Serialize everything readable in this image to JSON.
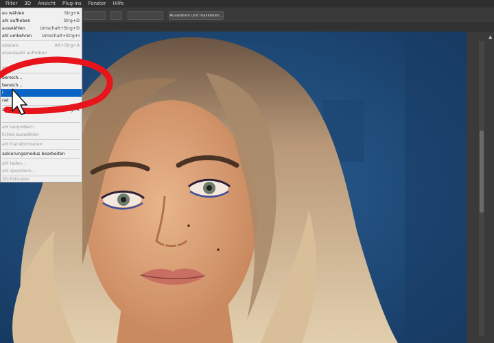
{
  "menubar": {
    "items": [
      "Filter",
      "3D",
      "Ansicht",
      "Plug-ins",
      "Fenster",
      "Hilfe"
    ]
  },
  "options": {
    "select_mask_button": "Auswählen und maskieren..."
  },
  "menu": {
    "items": [
      {
        "label": "eu wählen",
        "shortcut": "Strg+A",
        "disabled": false
      },
      {
        "label": "ahl aufheben",
        "shortcut": "Strg+D",
        "disabled": false
      },
      {
        "label": "auswählen",
        "shortcut": "Umschalt+Strg+D",
        "disabled": false
      },
      {
        "label": "ahl umkehren",
        "shortcut": "Umschalt+Strg+I",
        "disabled": false
      },
      {
        "label": "ebenen",
        "shortcut": "Alt+Strg+A",
        "disabled": true
      },
      {
        "label": "enauswahl aufheben",
        "shortcut": "",
        "disabled": true
      },
      {
        "label": "",
        "shortcut": "Alt+Umschalt+Strg+F",
        "disabled": true
      },
      {
        "label": "ebenen",
        "shortcut": "",
        "disabled": true
      },
      {
        "label": "bereich...",
        "shortcut": "",
        "disabled": false
      },
      {
        "label": "bereich...",
        "shortcut": "",
        "disabled": false
      },
      {
        "label": "l",
        "shortcut": "",
        "disabled": false,
        "selected": true
      },
      {
        "label": "nel",
        "shortcut": "",
        "disabled": false
      },
      {
        "label": "ählen und maskieren...",
        "shortcut": "Alt+Strg+R",
        "disabled": false
      },
      {
        "label": "",
        "shortcut": "",
        "disabled": false
      },
      {
        "label": "ahl vergrößern",
        "shortcut": "",
        "disabled": true
      },
      {
        "label": "liches auswählen",
        "shortcut": "",
        "disabled": true
      },
      {
        "label": "ahl transformieren",
        "shortcut": "",
        "disabled": true
      },
      {
        "label": "askierungsmodus bearbeiten",
        "shortcut": "",
        "disabled": false
      },
      {
        "label": "ahl laden...",
        "shortcut": "",
        "disabled": true
      },
      {
        "label": "ahl speichern...",
        "shortcut": "",
        "disabled": true
      },
      {
        "label": "3D-Extrusion",
        "shortcut": "",
        "disabled": true
      }
    ]
  },
  "colors": {
    "highlight": "#0a64c4",
    "annotation": "#e8141c",
    "canvas_bg": "#1f4a7a"
  }
}
